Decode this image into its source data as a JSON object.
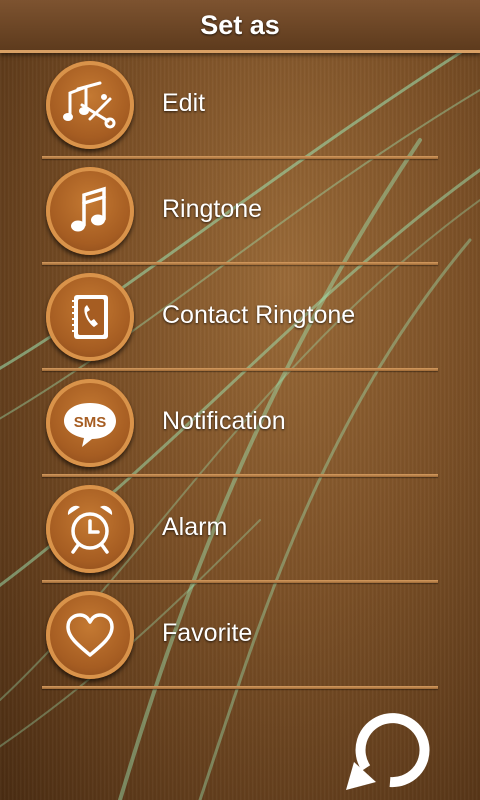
{
  "header": {
    "title": "Set as"
  },
  "menu": {
    "items": [
      {
        "label": "Edit",
        "icon": "music-scissors-icon"
      },
      {
        "label": "Ringtone",
        "icon": "music-note-icon"
      },
      {
        "label": "Contact Ringtone",
        "icon": "phone-book-icon"
      },
      {
        "label": "Notification",
        "icon": "sms-bubble-icon",
        "icon_text": "SMS"
      },
      {
        "label": "Alarm",
        "icon": "alarm-clock-icon"
      },
      {
        "label": "Favorite",
        "icon": "heart-icon"
      }
    ]
  },
  "footer": {
    "refresh_icon": "refresh-icon"
  },
  "colors": {
    "accent": "#d9a064",
    "badge": "#a65d22",
    "text": "#ffffff"
  }
}
